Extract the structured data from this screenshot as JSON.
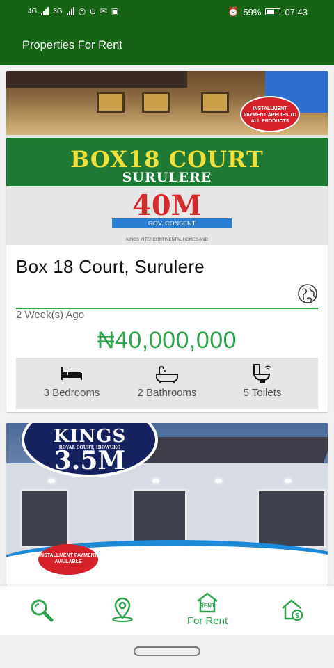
{
  "status_bar": {
    "left_indicators": [
      "4G",
      "3G"
    ],
    "battery": "59%",
    "time": "07:43"
  },
  "app_bar": {
    "title": "Properties For Rent"
  },
  "listings": [
    {
      "banner": {
        "headline": "BOX18 COURT",
        "subheadline": "SURULERE",
        "price_text": "40M",
        "consent": "GOV. CONSENT",
        "badge": "INSTALLMENT PAYMENT APPLIES TO ALL PRODUCTS",
        "footer": "KINGS INTERCONTINENTAL HOMES AND"
      },
      "title": "Box 18 Court, Surulere",
      "posted": "2 Week(s) Ago",
      "price": "₦40,000,000",
      "amenities": {
        "bedrooms": "3 Bedrooms",
        "bathrooms": "2 Bathrooms",
        "toilets": "5 Toilets"
      }
    },
    {
      "banner": {
        "headline": "KINGS",
        "tagline": "ROYAL COURT, IBOWUKO",
        "price_text": "3.5M",
        "badge": "INSTALLMENT PAYMENT AVAILABLE"
      }
    }
  ],
  "bottom_nav": {
    "items": [
      {
        "icon": "search-icon",
        "label": ""
      },
      {
        "icon": "map-pin-icon",
        "label": ""
      },
      {
        "icon": "rent-house-icon",
        "label": "For Rent"
      },
      {
        "icon": "sale-house-icon",
        "label": ""
      }
    ],
    "active_color": "#2ea34e"
  },
  "colors": {
    "app_bar": "#166316",
    "accent_green": "#2ea34e"
  }
}
